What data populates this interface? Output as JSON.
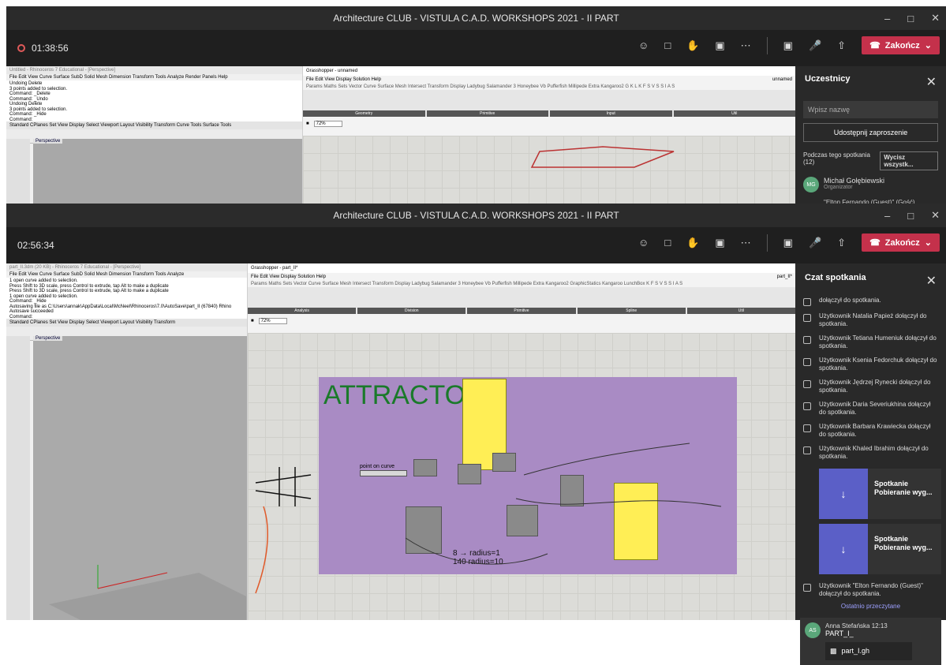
{
  "top": {
    "title": "Architecture CLUB - VISTULA C.A.D. WORKSHOPS 2021 - II PART",
    "timer": "01:38:56",
    "leave": "Zakończ",
    "rhino": {
      "title": "Untitled - Rhinoceros 7 Educational - [Perspective]",
      "menu": "File  Edit  View  Curve  Surface  SubD  Solid  Mesh  Dimension  Transform  Tools  Analyze  Render  Panels  Help",
      "cmd": [
        "Undoing Delete",
        "3 points added to selection.",
        "Command: _Delete",
        "Command: _Undo",
        "Undoing Delete",
        "3 points added to selection.",
        "Command: _Hide",
        "Command:"
      ],
      "tabs": "Standard  CPlanes  Set View  Display  Select  Viewport Layout  Visibility  Transform  Curve Tools  Surface Tools",
      "viewport": "Perspective"
    },
    "gh": {
      "title": "Grasshopper - unnamed",
      "menu": "File  Edit  View  Display  Solution  Help",
      "doc": "unnamed",
      "tabs": "Params  Maths  Sets  Vector  Curve  Surface  Mesh  Intersect  Transform  Display  Ladybug  Salamander 3  Honeybee  Vb  Pufferfish  Millipede  Extra  Kangaroo2  G  K  L  K  F  S  V  S  S  I  A  S",
      "groups": [
        "Geometry",
        "Primitive",
        "Input",
        "Util"
      ],
      "zoom": "72%"
    },
    "participants": {
      "title": "Uczestnicy",
      "search_placeholder": "Wpisz nazwę",
      "invite": "Udostępnij zaproszenie",
      "in_meeting": "Podczas tego spotkania (12)",
      "mute_all": "Wycisz wszystk...",
      "p1_name": "Michał Gołębiewski",
      "p1_role": "Organizator",
      "p1_initials": "MG",
      "p2_name": "\"Elton Fernando (Guest)\" (Gość)"
    }
  },
  "bottom": {
    "title": "Architecture CLUB - VISTULA C.A.D. WORKSHOPS 2021 - II PART",
    "timer": "02:56:34",
    "leave": "Zakończ",
    "rhino": {
      "title": "part_II.3dm (20 KB) - Rhinoceros 7 Educational - [Perspective]",
      "menu": "File  Edit  View  Curve  Surface  SubD  Solid  Mesh  Dimension  Transform  Tools  Analyze",
      "cmd": [
        "1 open curve added to selection.",
        "Press Shift to 3D scale, press Control to extrude, tap Alt to make a duplicate",
        "Press Shift to 3D scale, press Control to extrude, tap Alt to make a duplicate",
        "1 open curve added to selection.",
        "Command: _Hide",
        "Autosaving file as C:\\Users\\annak\\AppData\\Local\\McNeel\\Rhinoceros\\7.0\\AutoSave\\part_II (67840) Rhino",
        "Autosave succeeded",
        "Command:"
      ],
      "tabs": "Standard  CPlanes  Set View  Display  Select  Viewport Layout  Visibility  Transform",
      "viewport": "Perspective"
    },
    "gh": {
      "title": "Grasshopper - part_II*",
      "menu": "File  Edit  View  Display  Solution  Help",
      "doc": "part_II*",
      "tabs": "Params  Maths  Sets  Vector  Curve  Surface  Mesh  Intersect  Transform  Display  Ladybug  Salamander 3  Honeybee  Vb  Pufferfish  Millipede  Extra  Kangaroo2  GraphicStatics  Kangaroo  LunchBox  K  F  S  V  S  S  I  A  S",
      "groups": [
        "Analysis",
        "Division",
        "Primitive",
        "Spline",
        "Util"
      ],
      "zoom": "72%",
      "canvas_title": "ATTRACTOR",
      "point_on_curve": "point on curve",
      "note_line1": "8 → radius=1",
      "note_line2": "140  radius=10"
    },
    "chat": {
      "title": "Czat spotkania",
      "messages": [
        "dołączył do spotkania.",
        "Użytkownik Natalia Papież dołączył do spotkania.",
        "Użytkownik Tetiana Humeniuk dołączył do spotkania.",
        "Użytkownik Ksenia Fedorchuk dołączył do spotkania.",
        "Użytkownik Jędrzej Rynecki dołączył do spotkania.",
        "Użytkownik Daria Severiukhina dołączył do spotkania.",
        "Użytkownik Barbara Krawiecka dołączył do spotkania.",
        "Użytkownik Khaled Ibrahim dołączył do spotkania."
      ],
      "dl_title": "Spotkanie",
      "dl_sub": "Pobieranie wyg...",
      "last_msg": "Użytkownik \"Elton Fernando (Guest)\" dołączył do spotkania.",
      "last_read": "Ostatnio przeczytane",
      "sender": "Anna Stefańska",
      "sender_initials": "AS",
      "time": "12:13",
      "msg": "PART_I_",
      "file": "part_I.gh"
    }
  }
}
